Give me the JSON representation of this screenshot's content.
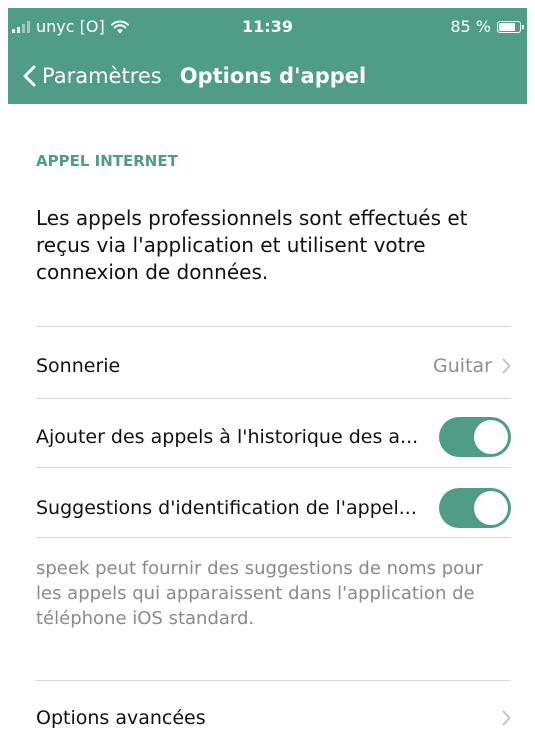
{
  "status_bar": {
    "carrier": "unyc [O]",
    "time": "11:39",
    "battery_text": "85 %",
    "battery_level": 0.85,
    "icons": [
      "signal-icon",
      "wifi-icon",
      "battery-icon"
    ]
  },
  "nav": {
    "back_label": "Paramètres",
    "title": "Options d'appel",
    "back_icon": "chevron-left-icon"
  },
  "section": {
    "title": "APPEL INTERNET",
    "description": "Les appels professionnels sont effectués et reçus via l'application et utilisent votre connexion de données."
  },
  "rows": {
    "ringtone": {
      "label": "Sonnerie",
      "value": "Guitar"
    },
    "history": {
      "label": "Ajouter des appels à l'historique des a...",
      "enabled": true
    },
    "caller_id": {
      "label": "Suggestions d'identification de l'appel...",
      "enabled": true
    },
    "advanced": {
      "label": "Options avancées"
    }
  },
  "footnote": "speek peut fournir des suggestions de noms pour les appels qui apparaissent dans l'application de téléphone iOS standard.",
  "colors": {
    "accent": "#4f9c87",
    "text": "#111111",
    "secondary_text": "#8a8a8a",
    "divider": "#d9d9d9"
  }
}
